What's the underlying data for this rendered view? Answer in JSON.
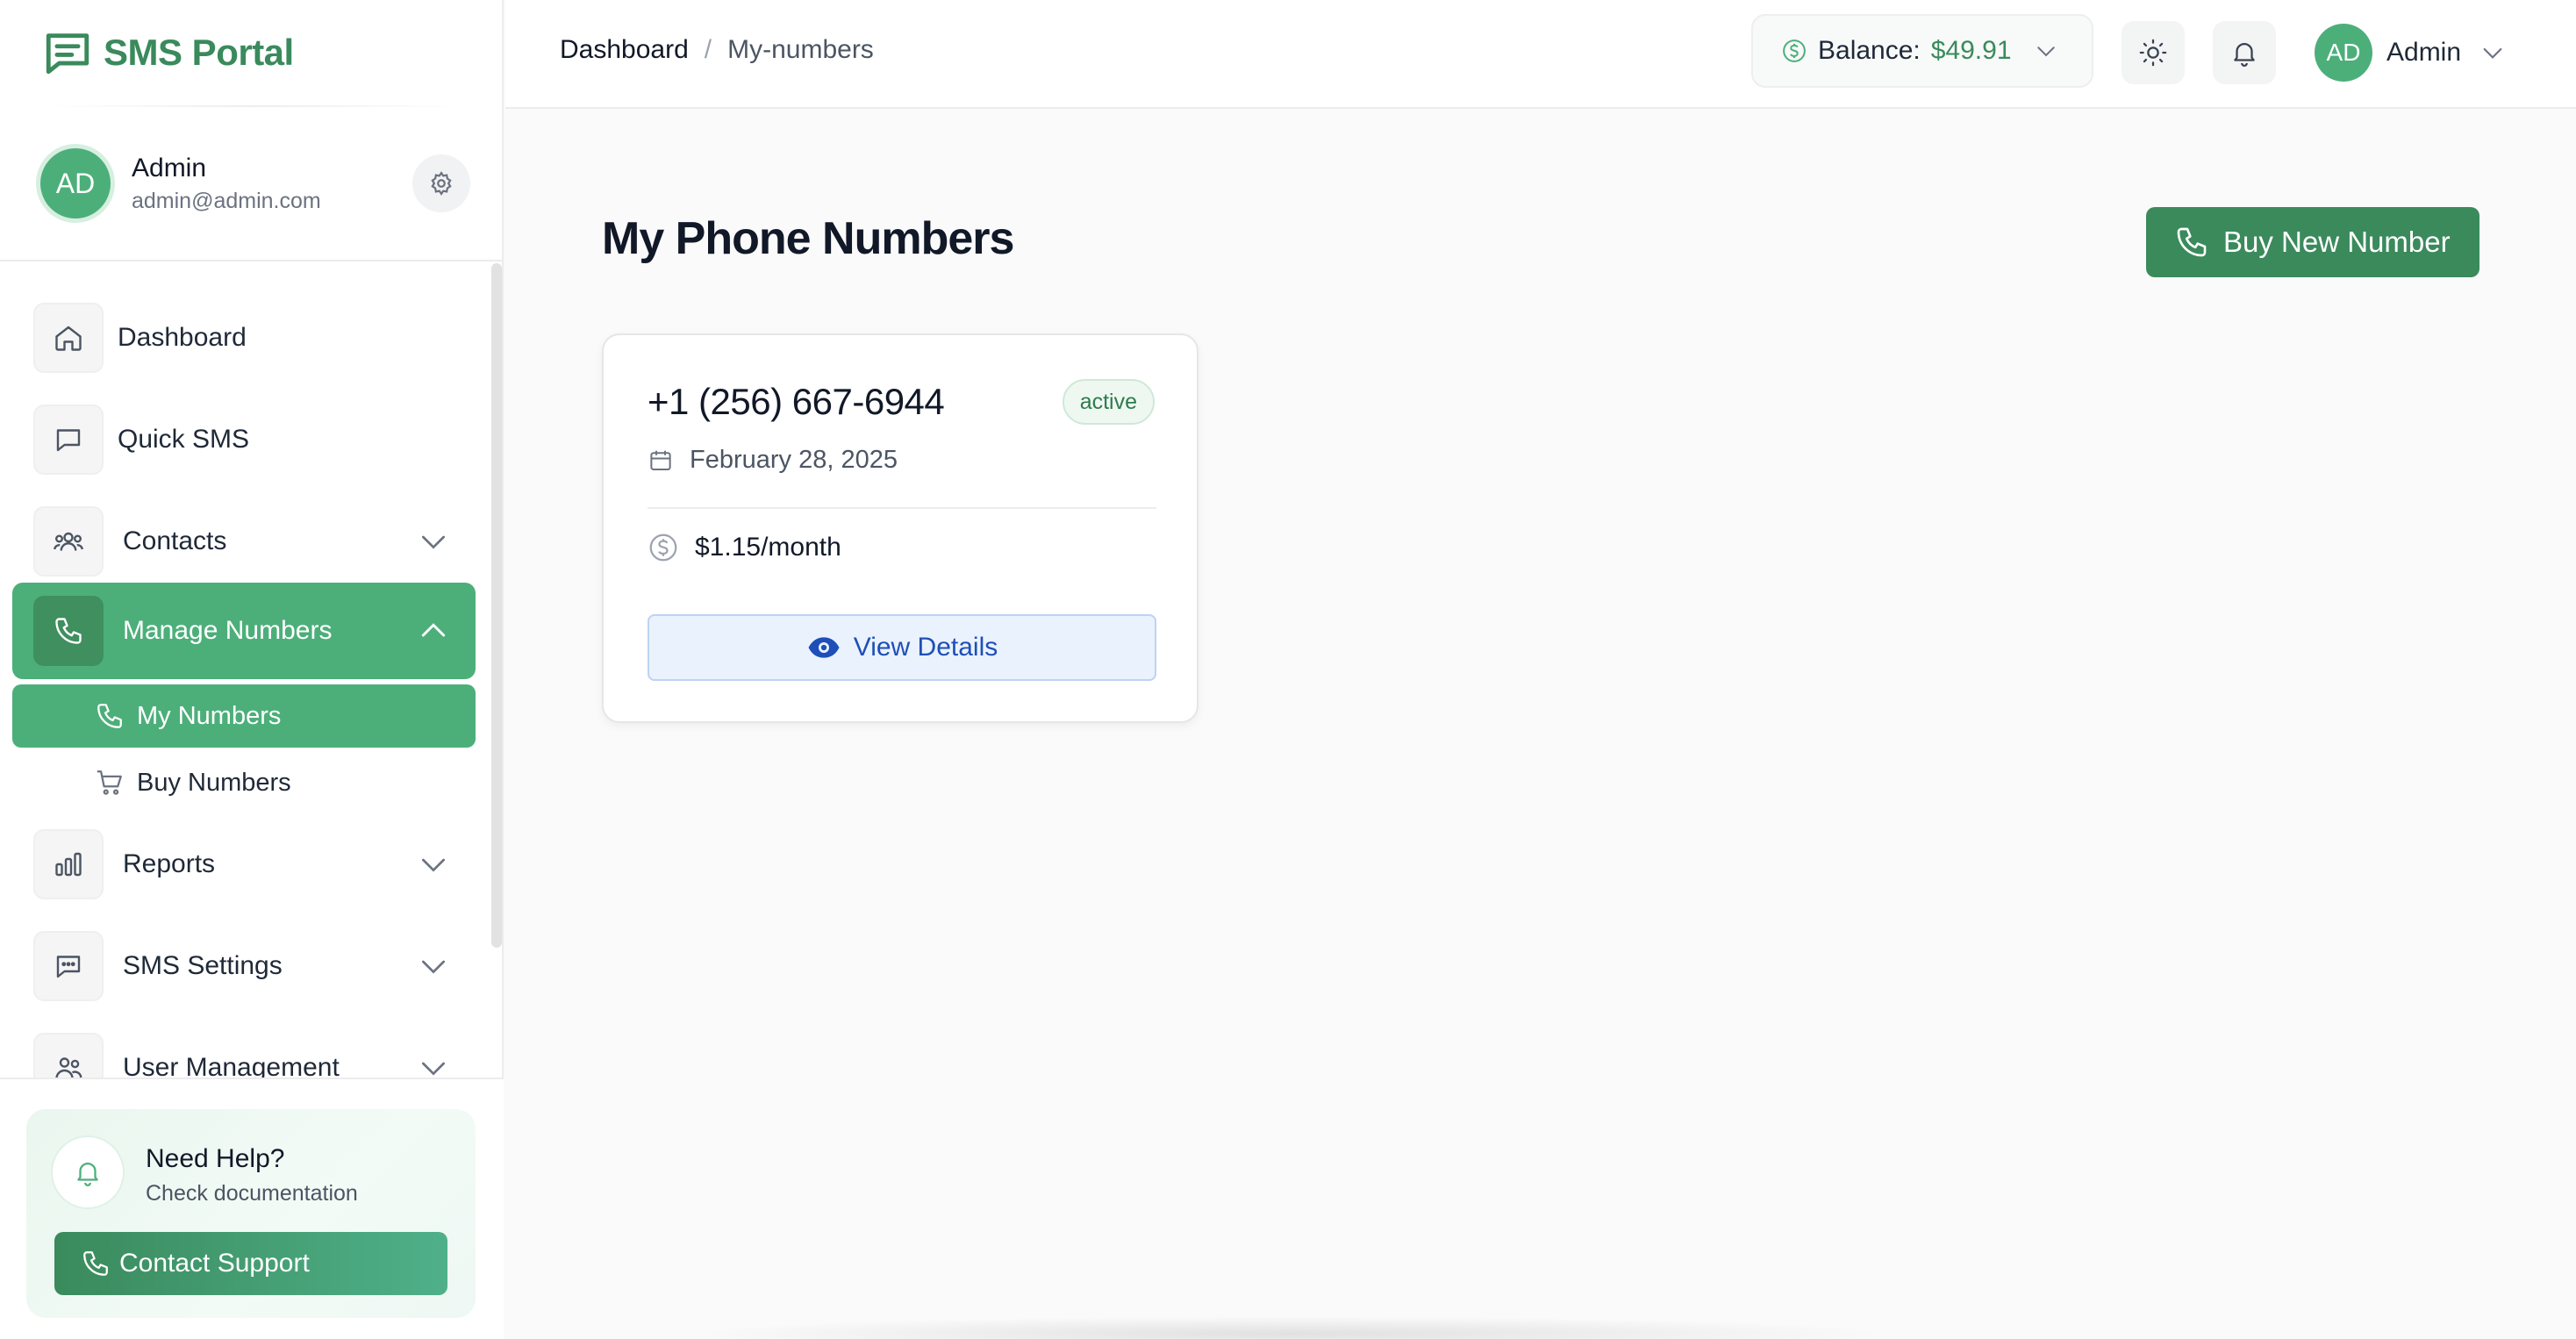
{
  "app": {
    "name": "SMS Portal"
  },
  "user": {
    "initials": "AD",
    "name": "Admin",
    "email": "admin@admin.com"
  },
  "sidebar": {
    "items": [
      {
        "label": "Dashboard",
        "icon": "home-icon"
      },
      {
        "label": "Quick SMS",
        "icon": "message-icon"
      },
      {
        "label": "Contacts",
        "icon": "users-icon",
        "expandable": true
      },
      {
        "label": "Manage Numbers",
        "icon": "phone-icon",
        "expandable": true,
        "expanded": true,
        "active": true
      },
      {
        "label": "Reports",
        "icon": "bar-chart-icon",
        "expandable": true
      },
      {
        "label": "SMS Settings",
        "icon": "message-dots-icon",
        "expandable": true
      },
      {
        "label": "User Management",
        "icon": "users-icon",
        "expandable": true
      }
    ],
    "sub_items": [
      {
        "label": "My Numbers",
        "icon": "phone-icon",
        "active": true
      },
      {
        "label": "Buy Numbers",
        "icon": "cart-icon"
      }
    ],
    "help": {
      "title": "Need Help?",
      "subtitle": "Check documentation",
      "button": "Contact Support"
    }
  },
  "topbar": {
    "breadcrumb": [
      "Dashboard",
      "/",
      "My-numbers"
    ],
    "balance_label": "Balance:",
    "balance_value": "$49.91",
    "profile_initials": "AD",
    "profile_name": "Admin"
  },
  "main": {
    "title": "My Phone Numbers",
    "buy_button": "Buy New Number",
    "numbers": [
      {
        "phone": "+1 (256) 667-6944",
        "status": "active",
        "date": "February 28, 2025",
        "price": "$1.15/month",
        "action": "View Details"
      }
    ]
  },
  "colors": {
    "brand_green": "#3a8a5c",
    "active_green": "#4caf7a",
    "details_blue": "#1e4fb8"
  }
}
